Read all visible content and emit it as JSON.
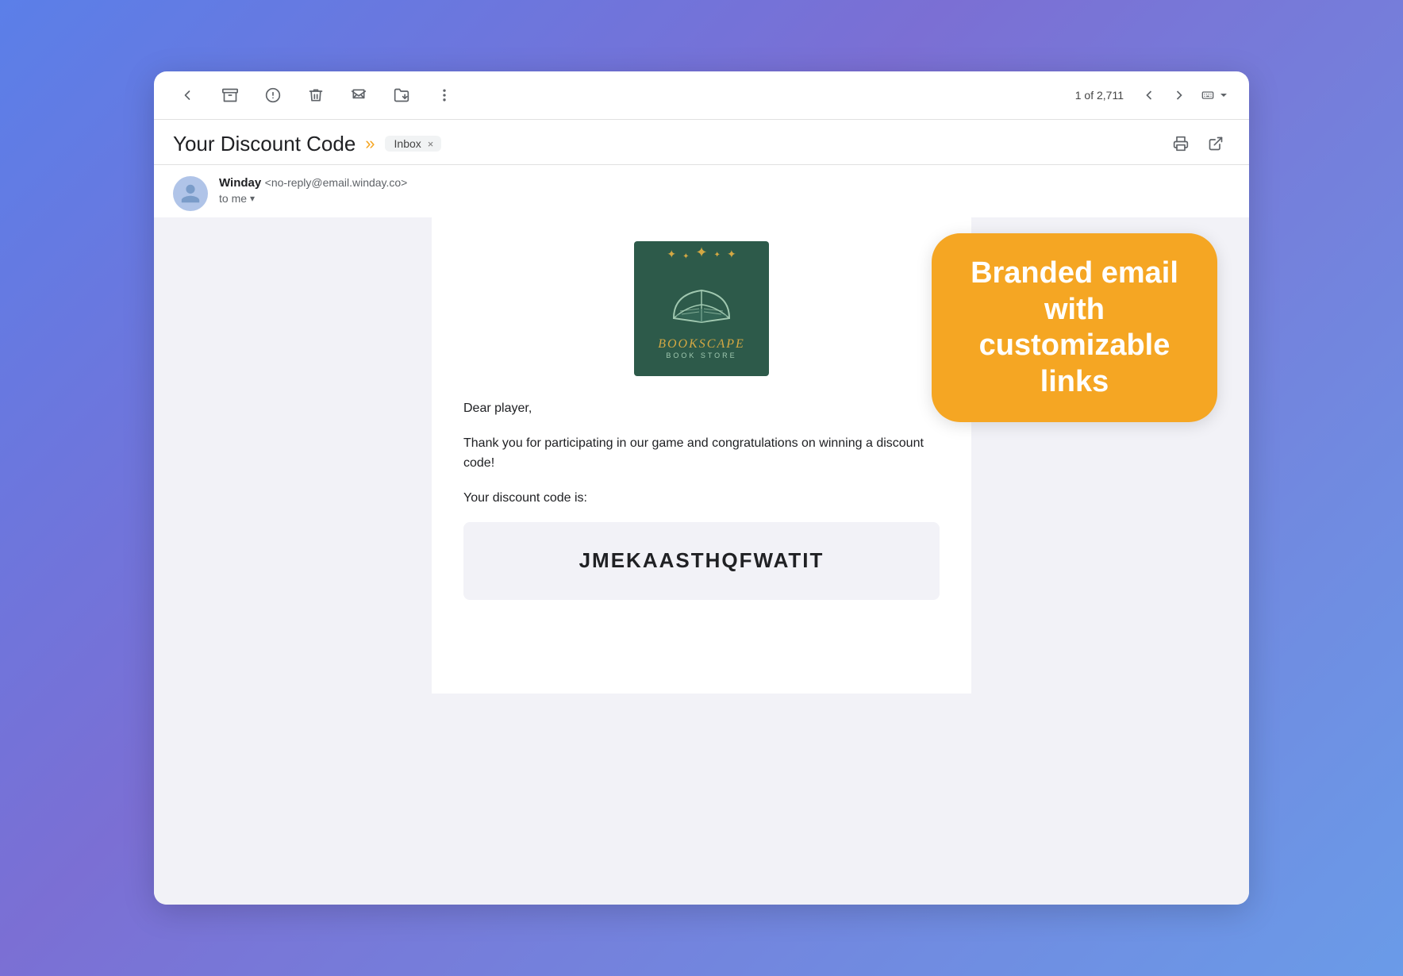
{
  "toolbar": {
    "nav_count": "1 of 2,711",
    "back_icon": "back-arrow",
    "archive_icon": "archive",
    "warning_icon": "report-spam",
    "delete_icon": "delete",
    "mark_read_icon": "mark-read",
    "move_icon": "move-to",
    "more_icon": "more-options",
    "prev_icon": "chevron-left",
    "next_icon": "chevron-right",
    "keyboard_icon": "keyboard"
  },
  "subject": {
    "title": "Your Discount Code",
    "arrow_char": "»",
    "inbox_label": "Inbox",
    "close_char": "×"
  },
  "sender": {
    "name": "Winday",
    "email": "<no-reply@email.winday.co>",
    "to_label": "to me",
    "chevron": "▾"
  },
  "callout": {
    "text": "Branded email with customizable links",
    "bg_color": "#f5a623"
  },
  "email_body": {
    "greeting": "Dear player,",
    "paragraph1": "Thank you for participating in our game and congratulations on winning a discount code!",
    "paragraph2": "Your discount code is:",
    "discount_code": "JMEKAASTHQFWATIT",
    "logo_name": "BOOKSCAPE",
    "logo_sub": "BOOK STORE"
  }
}
